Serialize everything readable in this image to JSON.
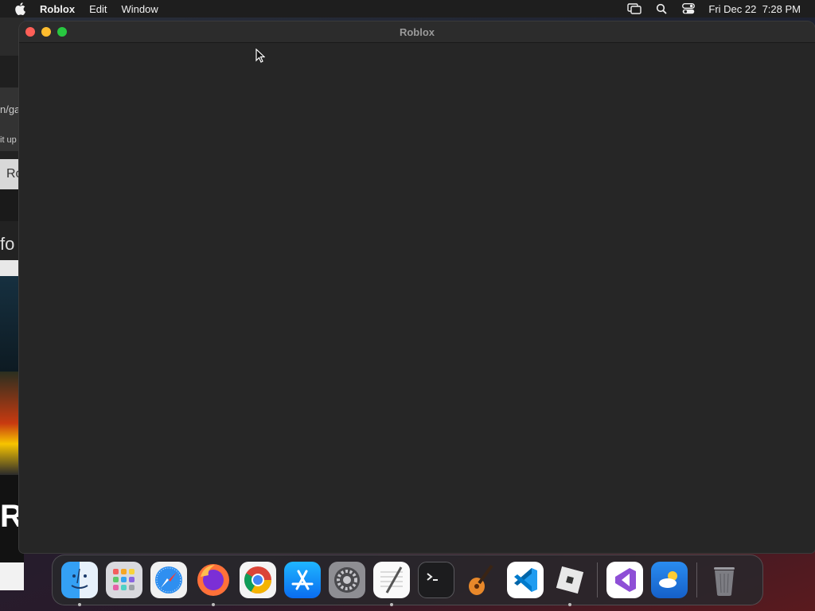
{
  "menubar": {
    "app_name": "Roblox",
    "menus": [
      "Edit",
      "Window"
    ],
    "clock": "Fri Dec 22  7:28 PM",
    "icons": [
      "apple-icon",
      "screen-mirroring-icon",
      "spotlight-search-icon",
      "control-center-icon"
    ]
  },
  "window": {
    "title": "Roblox"
  },
  "background_window": {
    "fragments": [
      "n/ga",
      "it up",
      "Ro",
      "fo",
      "RI"
    ]
  },
  "dock": {
    "apps": [
      {
        "name": "Finder",
        "icon": "finder-icon",
        "running": true
      },
      {
        "name": "Launchpad",
        "icon": "launchpad-icon",
        "running": false
      },
      {
        "name": "Safari",
        "icon": "safari-icon",
        "running": false
      },
      {
        "name": "Firefox",
        "icon": "firefox-icon",
        "running": true
      },
      {
        "name": "Google Chrome",
        "icon": "chrome-icon",
        "running": false
      },
      {
        "name": "App Store",
        "icon": "app-store-icon",
        "running": false
      },
      {
        "name": "System Preferences",
        "icon": "system-preferences-icon",
        "running": false
      },
      {
        "name": "TextEdit",
        "icon": "textedit-icon",
        "running": true
      },
      {
        "name": "Terminal",
        "icon": "terminal-icon",
        "running": false
      },
      {
        "name": "GarageBand",
        "icon": "garageband-icon",
        "running": false
      },
      {
        "name": "Visual Studio Code",
        "icon": "vscode-icon",
        "running": false
      },
      {
        "name": "Roblox",
        "icon": "roblox-icon",
        "running": true
      }
    ],
    "extra_apps": [
      {
        "name": "Visual Studio",
        "icon": "visual-studio-icon"
      },
      {
        "name": "Weather",
        "icon": "weather-icon"
      }
    ],
    "trash": {
      "name": "Trash",
      "icon": "trash-icon"
    }
  },
  "colors": {
    "close": "#ff5f57",
    "minimize": "#febc2e",
    "maximize": "#28c840",
    "window_bg": "#262626"
  }
}
